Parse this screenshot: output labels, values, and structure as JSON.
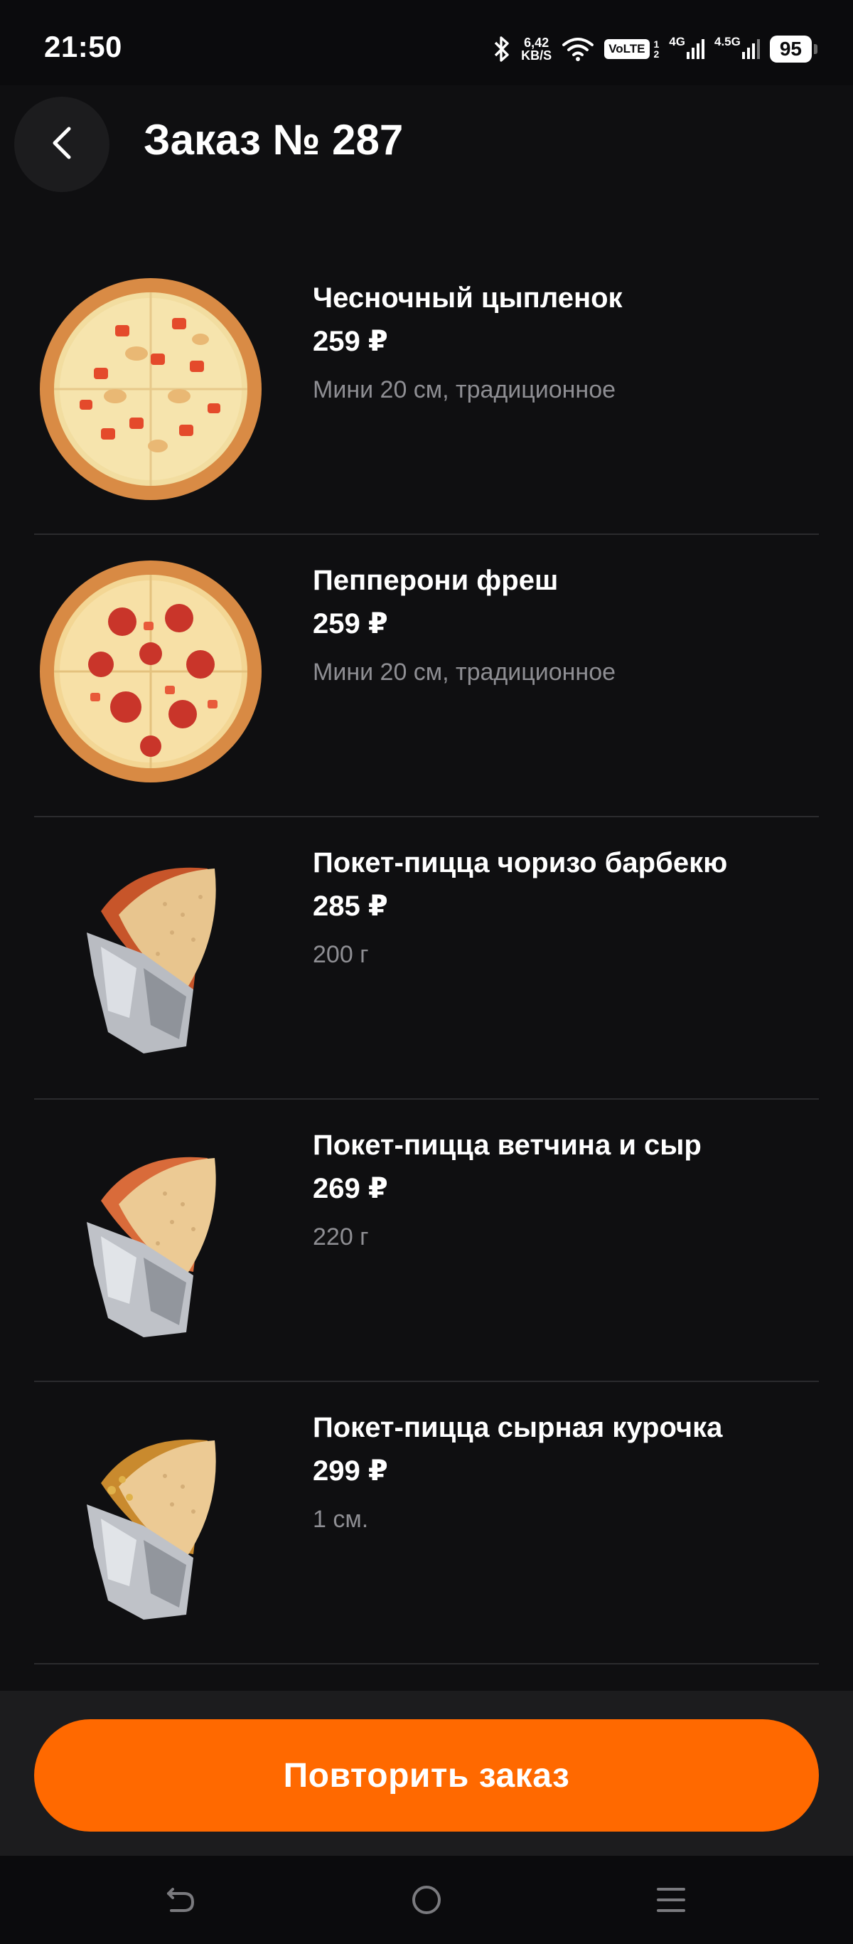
{
  "status_bar": {
    "time": "21:50",
    "speed_value": "6,42",
    "speed_unit": "KB/S",
    "volte": "VoLTE",
    "sim1": "1",
    "sim2": "2",
    "network1": "4G",
    "network2": "4.5G",
    "battery": "95"
  },
  "header": {
    "back_icon": "chevron-left-icon",
    "title": "Заказ № 287"
  },
  "order_items": [
    {
      "name": "Чесночный цыпленок",
      "price": "259 ₽",
      "details": "Мини 20  см, традиционное",
      "image": "pizza-garlic-chicken"
    },
    {
      "name": "Пепперони фреш",
      "price": "259 ₽",
      "details": "Мини 20  см, традиционное",
      "image": "pizza-pepperoni"
    },
    {
      "name": "Покет-пицца чоризо барбекю",
      "price": "285 ₽",
      "details": "200 г",
      "image": "pocket-pizza"
    },
    {
      "name": "Покет-пицца ветчина и сыр",
      "price": "269 ₽",
      "details": "220 г",
      "image": "pocket-pizza"
    },
    {
      "name": "Покет-пицца сырная курочка",
      "price": "299 ₽",
      "details": "1 см.",
      "image": "pocket-pizza"
    }
  ],
  "actions": {
    "repeat_order_label": "Повторить заказ"
  },
  "colors": {
    "background": "#0f0f11",
    "accent": "#ff6900",
    "muted_text": "#8e8e93",
    "divider": "#2b2b2e"
  }
}
